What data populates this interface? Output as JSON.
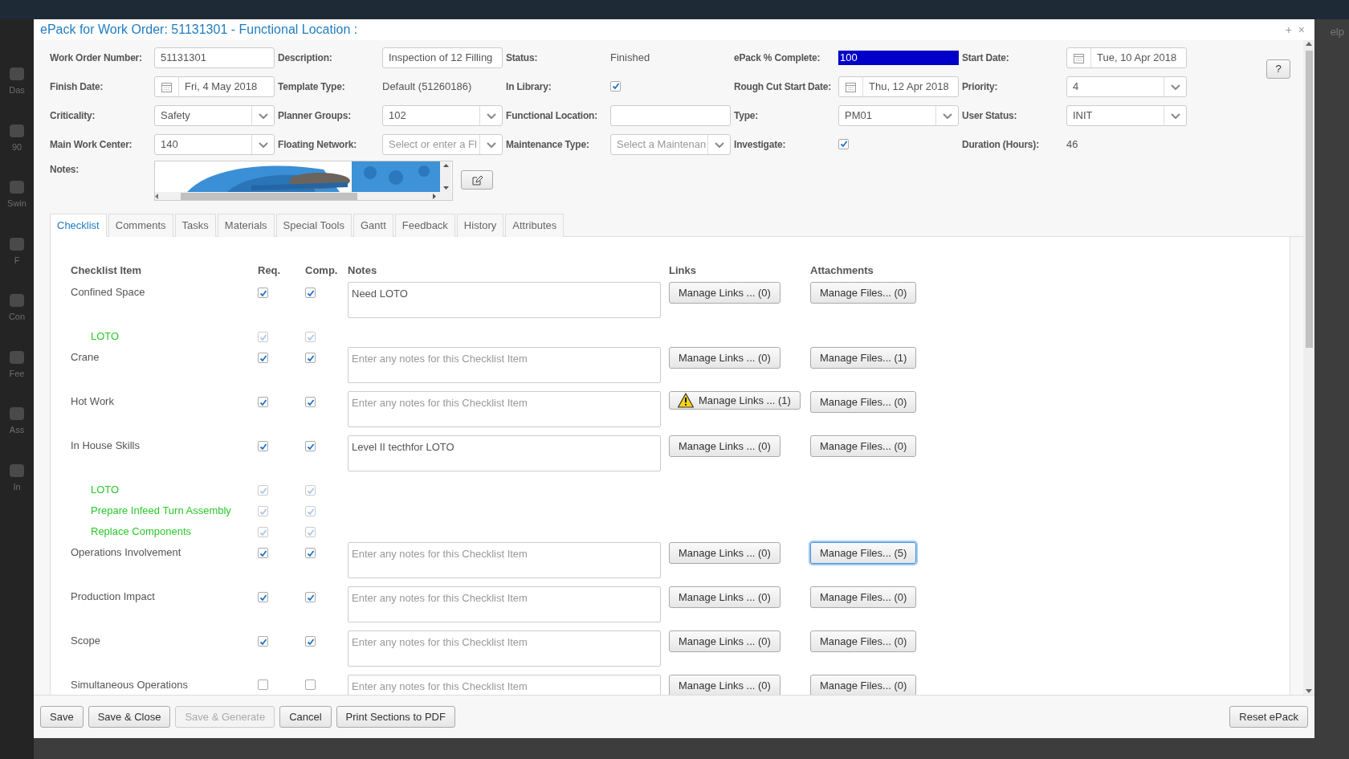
{
  "backdrop": {
    "sidebar": [
      {
        "label": "Das"
      },
      {
        "label": "90"
      },
      {
        "label": "Swin"
      },
      {
        "label": "F"
      },
      {
        "label": "Con"
      },
      {
        "label": "Fee"
      },
      {
        "label": "Ass"
      },
      {
        "label": "In"
      }
    ],
    "help_fragment": "elp"
  },
  "window": {
    "title": "ePack for Work Order: 51131301 - Functional Location :",
    "controls": [
      "+",
      "×"
    ],
    "help": "?"
  },
  "form": {
    "rows": [
      [
        {
          "label": "Work Order Number:",
          "kind": "input",
          "value": "51131301"
        },
        {
          "label": "Description:",
          "kind": "input",
          "value": "Inspection of 12 Filling"
        },
        {
          "label": "Status:",
          "kind": "text",
          "value": "Finished"
        },
        {
          "label": "ePack % Complete:",
          "kind": "highlight",
          "value": "100",
          "highlighted": true
        },
        {
          "label": "Start Date:",
          "kind": "date",
          "value": "Tue, 10 Apr 2018"
        }
      ],
      [
        {
          "label": "Finish Date:",
          "kind": "date",
          "value": "Fri, 4 May 2018"
        },
        {
          "label": "Template Type:",
          "kind": "text",
          "value": "Default (51260186)"
        },
        {
          "label": "In Library:",
          "kind": "checkbox",
          "checked": true
        },
        {
          "label": "Rough Cut Start Date:",
          "kind": "date",
          "value": "Thu, 12 Apr 2018"
        },
        {
          "label": "Priority:",
          "kind": "select",
          "value": "4"
        }
      ],
      [
        {
          "label": "Criticality:",
          "kind": "select",
          "value": "Safety"
        },
        {
          "label": "Planner Groups:",
          "kind": "select",
          "value": "102"
        },
        {
          "label": "Functional Location:",
          "kind": "input"
        },
        {
          "label": "Type:",
          "kind": "select",
          "value": "PM01"
        },
        {
          "label": "User Status:",
          "kind": "select",
          "value": "INIT"
        }
      ],
      [
        {
          "label": "Main Work Center:",
          "kind": "select",
          "value": "140"
        },
        {
          "label": "Floating Network:",
          "kind": "select",
          "placeholder": "Select or enter a Fl"
        },
        {
          "label": "Maintenance Type:",
          "kind": "select",
          "placeholder": "Select a Maintenan"
        },
        {
          "label": "Investigate:",
          "kind": "checkbox",
          "checked": true
        },
        {
          "label": "Duration (Hours):",
          "kind": "text",
          "value": "46"
        }
      ]
    ],
    "notes_label": "Notes:"
  },
  "tabs": [
    {
      "label": "Checklist",
      "selected": true
    },
    {
      "label": "Comments",
      "selected": false
    },
    {
      "label": "Tasks",
      "selected": false
    },
    {
      "label": "Materials",
      "selected": false
    },
    {
      "label": "Special Tools",
      "selected": false
    },
    {
      "label": "Gantt",
      "selected": false
    },
    {
      "label": "Feedback",
      "selected": false
    },
    {
      "label": "History",
      "selected": false
    },
    {
      "label": "Attributes",
      "selected": false
    }
  ],
  "checklist": {
    "columns": [
      "Checklist Item",
      "Req.",
      "Comp.",
      "Notes",
      "Links",
      "Attachments"
    ],
    "rows": [
      {
        "kind": "item",
        "name": "Confined Space",
        "req": true,
        "comp": true,
        "notes": "Need LOTO",
        "links": {
          "label": "Manage Links ... (0)",
          "warning": false
        },
        "files": {
          "label": "Manage Files... (0)",
          "focused": false
        }
      },
      {
        "kind": "sub",
        "name": "LOTO",
        "req": true,
        "comp": true
      },
      {
        "kind": "item",
        "name": "Crane",
        "req": true,
        "comp": true,
        "placeholder": "Enter any notes for this Checklist Item",
        "links": {
          "label": "Manage Links ... (0)",
          "warning": false
        },
        "files": {
          "label": "Manage Files... (1)",
          "focused": false
        }
      },
      {
        "kind": "item",
        "name": "Hot Work",
        "req": true,
        "comp": true,
        "placeholder": "Enter any notes for this Checklist Item",
        "links": {
          "label": "Manage Links ... (1)",
          "warning": true
        },
        "files": {
          "label": "Manage Files... (0)",
          "focused": false
        }
      },
      {
        "kind": "item",
        "name": "In House Skills",
        "req": true,
        "comp": true,
        "notes": "Level II tecthfor LOTO",
        "links": {
          "label": "Manage Links ... (0)",
          "warning": false
        },
        "files": {
          "label": "Manage Files... (0)",
          "focused": false
        }
      },
      {
        "kind": "sub",
        "name": "LOTO",
        "req": true,
        "comp": true
      },
      {
        "kind": "sub",
        "name": "Prepare Infeed Turn Assembly",
        "req": true,
        "comp": true
      },
      {
        "kind": "sub",
        "name": "Replace Components",
        "req": true,
        "comp": true
      },
      {
        "kind": "item",
        "name": "Operations Involvement",
        "req": true,
        "comp": true,
        "placeholder": "Enter any notes for this Checklist Item",
        "links": {
          "label": "Manage Links ... (0)",
          "warning": false
        },
        "files": {
          "label": "Manage Files... (5)",
          "focused": true
        }
      },
      {
        "kind": "item",
        "name": "Production Impact",
        "req": true,
        "comp": true,
        "placeholder": "Enter any notes for this Checklist Item",
        "links": {
          "label": "Manage Links ... (0)",
          "warning": false
        },
        "files": {
          "label": "Manage Files... (0)",
          "focused": false
        }
      },
      {
        "kind": "item",
        "name": "Scope",
        "req": true,
        "comp": true,
        "placeholder": "Enter any notes for this Checklist Item",
        "links": {
          "label": "Manage Links ... (0)",
          "warning": false
        },
        "files": {
          "label": "Manage Files... (0)",
          "focused": false
        }
      },
      {
        "kind": "item",
        "name": "Simultaneous Operations",
        "req": false,
        "comp": false,
        "placeholder": "Enter any notes for this Checklist Item",
        "links": {
          "label": "Manage Links ... (0)",
          "warning": false
        },
        "files": {
          "label": "Manage Files... (0)",
          "focused": false
        }
      }
    ]
  },
  "footer": {
    "left_buttons": [
      {
        "label": "Save",
        "disabled": false
      },
      {
        "label": "Save & Close",
        "disabled": false
      },
      {
        "label": "Save & Generate",
        "disabled": true
      },
      {
        "label": "Cancel",
        "disabled": false
      },
      {
        "label": "Print Sections to PDF",
        "disabled": false
      }
    ],
    "right_buttons": [
      {
        "label": "Reset ePack",
        "disabled": false
      }
    ]
  }
}
